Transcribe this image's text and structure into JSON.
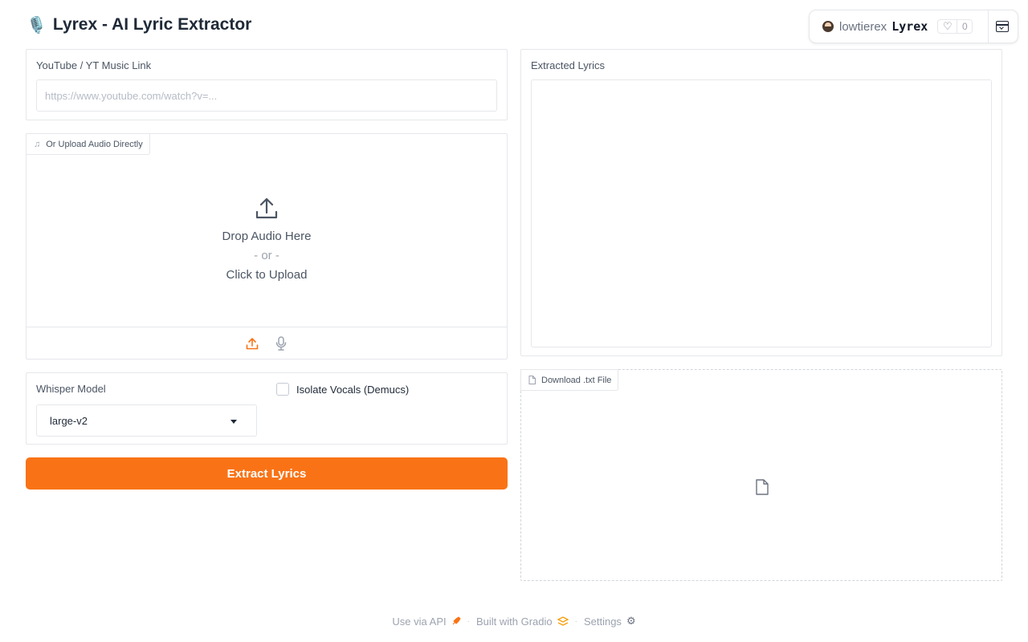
{
  "app": {
    "title": "Lyrex - AI Lyric Extractor",
    "title_emoji": "🎙️"
  },
  "space_header": {
    "owner": "lowtierex",
    "space": "Lyrex",
    "likes": "0"
  },
  "url_input": {
    "label": "YouTube / YT Music Link",
    "value": "",
    "placeholder": "https://www.youtube.com/watch?v=..."
  },
  "upload": {
    "label": "Or Upload Audio Directly",
    "drop_text": "Drop Audio Here",
    "or_text": "- or -",
    "click_text": "Click to Upload"
  },
  "options": {
    "model_label": "Whisper Model",
    "model_value": "large-v2",
    "isolate_label": "Isolate Vocals (Demucs)",
    "isolate_checked": false
  },
  "actions": {
    "extract_label": "Extract Lyrics"
  },
  "output": {
    "lyrics_label": "Extracted Lyrics",
    "lyrics_value": "",
    "download_label": "Download .txt File"
  },
  "footer": {
    "api_label": "Use via API",
    "built_label": "Built with Gradio",
    "settings_label": "Settings"
  },
  "colors": {
    "accent": "#f97316",
    "border": "#e5e7eb",
    "muted_text": "#9ca3af"
  },
  "icons": {
    "upload_tab": "music-note-icon",
    "dropzone": "upload-arrow-icon",
    "source_upload": "upload-icon",
    "source_mic": "microphone-icon",
    "download_tab": "file-icon",
    "space_expand": "expand-panel-icon"
  }
}
